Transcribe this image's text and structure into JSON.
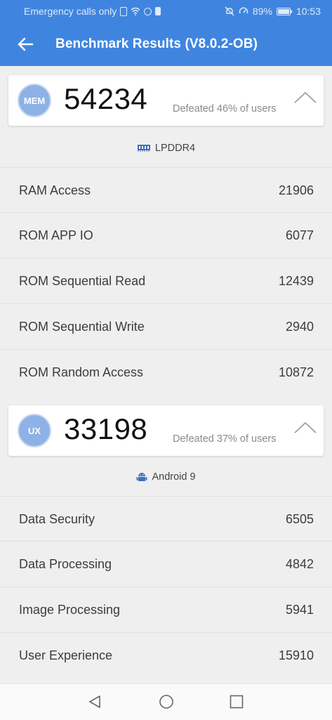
{
  "status_bar": {
    "carrier": "Emergency calls only",
    "battery": "89%",
    "time": "10:53"
  },
  "app_bar": {
    "title": "Benchmark Results (V8.0.2-OB)"
  },
  "mem": {
    "badge": "MEM",
    "score": "54234",
    "defeated": "Defeated 46% of users",
    "sub_label": "LPDDR4",
    "rows": [
      {
        "label": "RAM Access",
        "value": "21906"
      },
      {
        "label": "ROM APP IO",
        "value": "6077"
      },
      {
        "label": "ROM Sequential Read",
        "value": "12439"
      },
      {
        "label": "ROM Sequential Write",
        "value": "2940"
      },
      {
        "label": "ROM Random Access",
        "value": "10872"
      }
    ]
  },
  "ux": {
    "badge": "UX",
    "score": "33198",
    "defeated": "Defeated 37% of users",
    "sub_label": "Android 9",
    "rows": [
      {
        "label": "Data Security",
        "value": "6505"
      },
      {
        "label": "Data Processing",
        "value": "4842"
      },
      {
        "label": "Image Processing",
        "value": "5941"
      },
      {
        "label": "User Experience",
        "value": "15910"
      }
    ]
  },
  "colors": {
    "accent": "#3f85e0",
    "badge": "#8eb2e5"
  },
  "icons": {
    "back": "back-arrow-icon",
    "collapse": "chevron-up-icon",
    "memory": "memory-chip-icon",
    "android": "android-icon",
    "nav_back": "nav-back-icon",
    "nav_home": "nav-home-icon",
    "nav_recents": "nav-recents-icon"
  }
}
